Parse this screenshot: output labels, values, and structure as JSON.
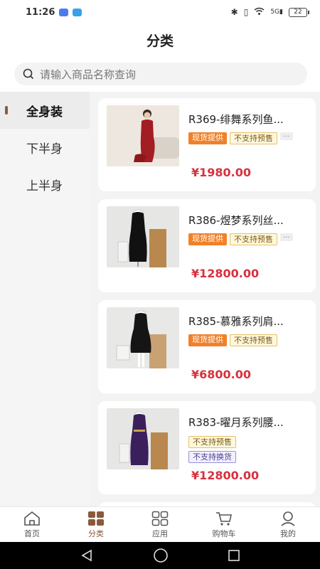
{
  "status_bar": {
    "time": "11:26",
    "network": "5G",
    "battery": "22",
    "app_icon_colors": [
      "#4a7cf0",
      "#3aa0e8"
    ]
  },
  "header": {
    "title": "分类"
  },
  "search": {
    "placeholder": "请输入商品名称查询"
  },
  "sidebar": {
    "accent": "#8b5a3c",
    "items": [
      {
        "label": "全身装",
        "active": true
      },
      {
        "label": "下半身",
        "active": false
      },
      {
        "label": "上半身",
        "active": false
      }
    ]
  },
  "products": [
    {
      "title": "R369-绯舞系列鱼...",
      "tags": [
        "现货提供",
        "不支持预售",
        "..."
      ],
      "price": "¥1980.00",
      "image": "red-dress-model"
    },
    {
      "title": "R386-煜梦系列丝...",
      "tags": [
        "现货提供",
        "不支持预售",
        "..."
      ],
      "price": "¥12800.00",
      "image": "black-dress-mannequin"
    },
    {
      "title": "R385-慕雅系列肩...",
      "tags": [
        "现货提供",
        "不支持预售"
      ],
      "price": "¥6800.00",
      "image": "black-midi-dress-mannequin"
    },
    {
      "title": "R383-曜月系列腰...",
      "tags": [
        "不支持预售",
        "不支持换货"
      ],
      "price": "¥12800.00",
      "image": "purple-gown-mannequin"
    }
  ],
  "tabbar": {
    "items": [
      {
        "label": "首页",
        "icon": "home-icon",
        "active": false
      },
      {
        "label": "分类",
        "icon": "category-icon",
        "active": true
      },
      {
        "label": "应用",
        "icon": "apps-icon",
        "active": false
      },
      {
        "label": "购物车",
        "icon": "cart-icon",
        "active": false
      },
      {
        "label": "我的",
        "icon": "profile-icon",
        "active": false
      }
    ]
  },
  "colors": {
    "price": "#d9303d",
    "tag_orange": "#f0812a",
    "active_tab": "#8b5a3c"
  }
}
